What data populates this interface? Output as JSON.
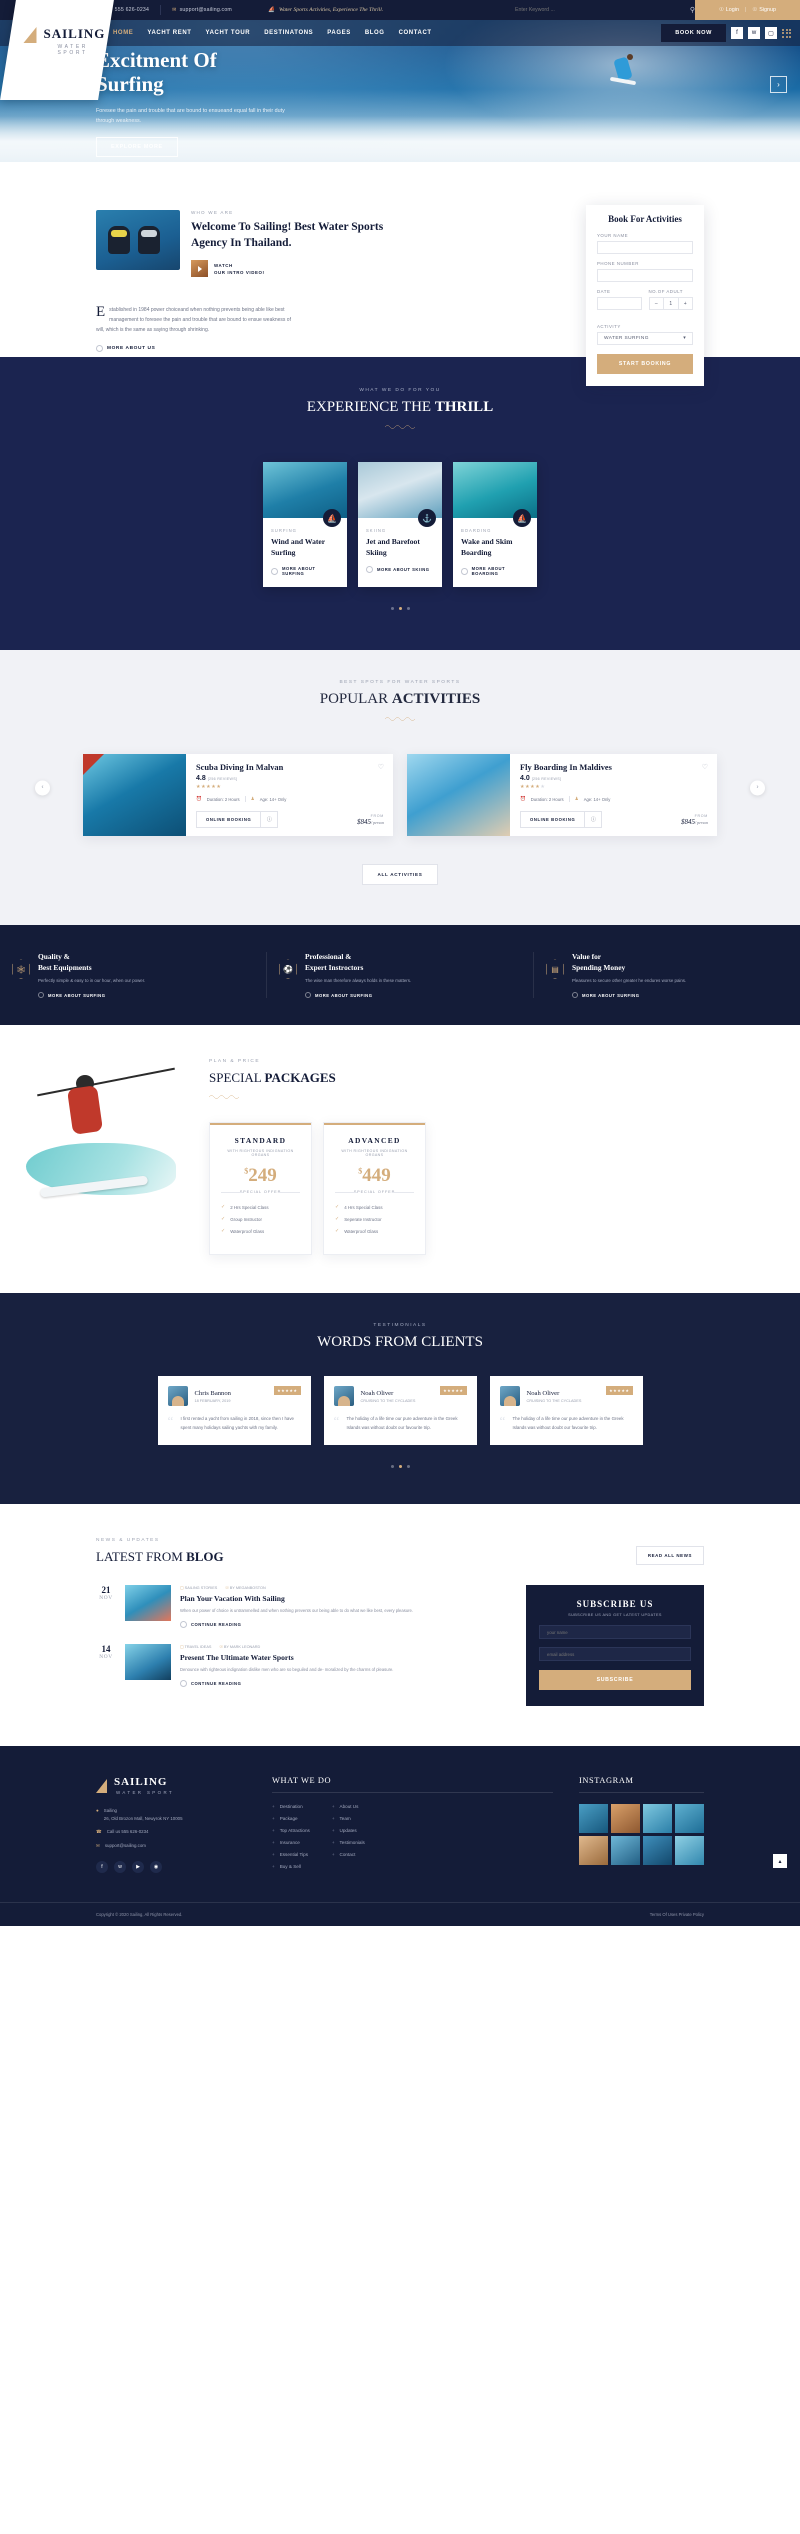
{
  "topbar": {
    "phone": "555 626-0234",
    "email": "support@sailing.com",
    "tagline": "Water Sports Activities, Experience The Thrill.",
    "search_placeholder": "Enter Keyword ...",
    "login": "Login",
    "signup": "Signup"
  },
  "logo": {
    "name": "SAILING",
    "sub": "WATER SPORT"
  },
  "nav": {
    "items": [
      "HOME",
      "YACHT RENT",
      "YACHT TOUR",
      "DESTINATONS",
      "PAGES",
      "BLOG",
      "CONTACT"
    ],
    "active": "HOME",
    "book_now": "BOOK NOW"
  },
  "hero": {
    "title_line1": "Excitment Of",
    "title_line2": "Surfing",
    "text": "Foresee the pain and trouble that are bound to ensueand equal fall in their duty through weakness.",
    "button": "EXPLORE MORE"
  },
  "booking": {
    "title": "Book For Activities",
    "name_label": "YOUR NAME",
    "phone_label": "PHONE NUMBER",
    "date_label": "DATE",
    "adult_label": "NO.OF ADULT",
    "adult_value": "1",
    "minus": "–",
    "plus": "+",
    "activity_label": "ACTIVITY",
    "activity_value": "WATER SURFING",
    "submit": "START BOOKING"
  },
  "about": {
    "eyebrow": "WHO WE ARE",
    "title": "Welcome To Sailing! Best Water Sports Agency In Thailand.",
    "watch_line1": "WATCH",
    "watch_line2": "OUR INTRO VIDEO!",
    "dropcap": "E",
    "body": "stablished in 1984 power choiceand when nothing prevents being able like best management to foresee the pain and trouble that are bound to ensue weakness of will, which is the same as saying through shrinking.",
    "more": "MORE ABOUT US"
  },
  "thrill": {
    "eyebrow": "WHAT WE DO FOR YOU",
    "title_light": "EXPERIENCE THE ",
    "title_bold": "THRILL",
    "cards": [
      {
        "cat": "SURFING",
        "title": "Wind and Water Surfing",
        "link": "MORE ABOUT SURFING",
        "icon": "windsurf-icon"
      },
      {
        "cat": "SKIING",
        "title": "Jet and Barefoot Skiing",
        "link": "MORE ABOUT SKIING",
        "icon": "jetski-icon"
      },
      {
        "cat": "BOARDING",
        "title": "Wake and Skim Boarding",
        "link": "MORE ABOUT BOARDING",
        "icon": "sailboat-icon"
      }
    ]
  },
  "popular": {
    "eyebrow": "BEST SPOTS FOR WATER SPORTS",
    "title_light": "POPULAR ",
    "title_bold": "ACTIVITIES",
    "all_button": "ALL ACTIVITIES",
    "items": [
      {
        "title": "Scuba Diving In Malvan",
        "rating": "4.8",
        "reviews": "[256 REVIEWS]",
        "stars": 5,
        "duration": "Duration: 2 Hours",
        "age": "Age: 14+ Only",
        "book": "ONLINE BOOKING",
        "from": "FROM",
        "price": "$845",
        "unit": "/ person"
      },
      {
        "title": "Fly Boarding In Maldives",
        "rating": "4.0",
        "reviews": "[256 REVIEWS]",
        "stars": 4,
        "duration": "Duration: 2 Hours",
        "age": "Age: 14+ Only",
        "book": "ONLINE BOOKING",
        "from": "FROM",
        "price": "$845",
        "unit": "/ person"
      }
    ]
  },
  "features": [
    {
      "title": "Quality &\nBest Equipments",
      "text": "Perfectly simple & easy to in our hour, when our power.",
      "link": "MORE ABOUT SURFING",
      "icon": "snorkel-mask-icon"
    },
    {
      "title": "Professional &\nExpert Instroctors",
      "text": "The wise man therefore always holds in these matters.",
      "link": "MORE ABOUT SURFING",
      "icon": "instructor-icon"
    },
    {
      "title": "Value for\nSpending Money",
      "text": "Pleasures to secure other greater he endures worse pains.",
      "link": "MORE ABOUT SURFING",
      "icon": "wallet-icon"
    }
  ],
  "packages": {
    "eyebrow": "PLAN & PRICE",
    "title_light": "SPECIAL ",
    "title_bold": "PACKAGES",
    "plans": [
      {
        "name": "STANDARD",
        "sub": "WITH RIGHTEOUS INDIGNATION ORGANS",
        "currency": "$",
        "amount": "249",
        "special": "SPECIAL OFFER",
        "features": [
          "2 Hrs Special Class",
          "Group Instructor",
          "Waterproof Glass"
        ]
      },
      {
        "name": "ADVANCED",
        "sub": "WITH RIGHTEOUS INDIGNATION ORGANS",
        "currency": "$",
        "amount": "449",
        "special": "SPECIAL OFFER",
        "features": [
          "4 Hrs Special Class",
          "Seperate Instructor",
          "Waterproof Glass"
        ]
      }
    ]
  },
  "testimonials": {
    "eyebrow": "TESTIMONIALS",
    "title": "WORDS FROM CLIENTS",
    "items": [
      {
        "name": "Chris Bannon",
        "date": "18 FEBRUARY, 2019",
        "text": "I first rented a yacht from sailing in 2018, since then I have spent many holidays sailing yachts with my family."
      },
      {
        "name": "Noah Oliver",
        "date": "CRUISING TO THE CYCLADES",
        "text": "The holiday of a life time our pure adventure in the Greek Islands was without doubt our favourite trip."
      },
      {
        "name": "Noah Oliver",
        "date": "CRUISING TO THE CYCLADES",
        "text": "The holiday of a life time our pure adventure in the Greek Islands was without doubt our favourite trip."
      }
    ]
  },
  "blog": {
    "eyebrow": "NEWS & UPDATES",
    "title_light": "LATEST FROM ",
    "title_bold": "BLOG",
    "read_all": "READ ALL NEWS",
    "posts": [
      {
        "day": "21",
        "month": "NOV",
        "cat": "SAILING STORIES",
        "author": "BY MEGANBOSTON",
        "title": "Plan Your Vacation With Sailing",
        "text": "When our power of choice is untrammelled and when nothing prevents our being able to do what we like best, every pleasure.",
        "link": "CONTINUE READING"
      },
      {
        "day": "14",
        "month": "NOV",
        "cat": "TRAVEL IDEAS",
        "author": "BY MARK LEONARD",
        "title": "Present The Ultimate Water Sports",
        "text": "Denounce with righteous indignation dislike men who are so beguiled and de- moralized by the charms of pleasure.",
        "link": "CONTINUE READING"
      }
    ],
    "subscribe": {
      "title": "SUBSCRIBE US",
      "sub": "SUBSCRIBE US AND GET LATEST UPDATES",
      "name_placeholder": "your name",
      "email_placeholder": "email address",
      "button": "SUBSCRIBE"
    }
  },
  "footer": {
    "logo_name": "SAILING",
    "logo_sub": "WATER SPORT",
    "company": "Sailing",
    "address": "26, Old Brozon Mall, Newyrok NY 10005",
    "phone": "Call us 555 626-0234",
    "email": "support@sailing.com",
    "what_we_do": "WHAT WE DO",
    "links_col1": [
      "Destination",
      "Package",
      "Top Attractions",
      "Insurance",
      "Essential Tips",
      "Buy & Sell"
    ],
    "links_col2": [
      "About Us",
      "Team",
      "Updates",
      "Testimonials",
      "Contact"
    ],
    "instagram": "INSTAGRAM",
    "copyright": "Copyright © 2020 Sailing, All Rights Reserved.",
    "terms": "Terms Of Uses  Private Policy",
    "socials": [
      "f",
      "t",
      "y",
      "r"
    ]
  },
  "colors": {
    "navy": "#141c38",
    "gold": "#d4ad7c",
    "light": "#f1f2f6"
  }
}
